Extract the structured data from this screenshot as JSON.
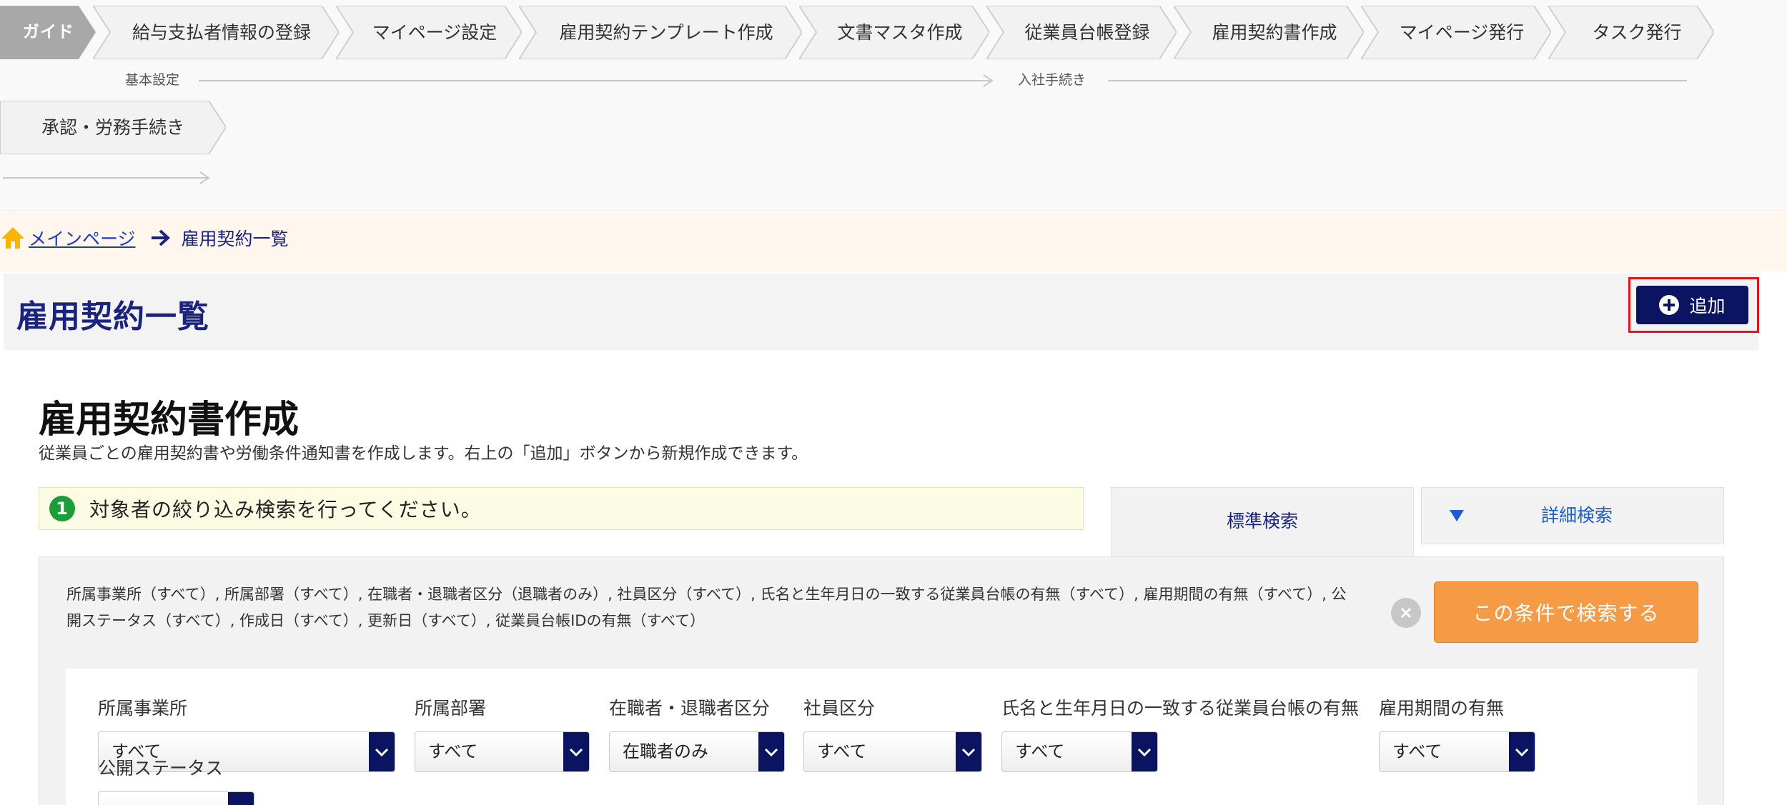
{
  "guide": {
    "badge": "ガイド",
    "steps": [
      "給与支払者情報の登録",
      "マイページ設定",
      "雇用契約テンプレート作成",
      "文書マスタ作成",
      "従業員台帳登録",
      "雇用契約書作成",
      "マイページ発行",
      "タスク発行",
      "承認・労務手続き"
    ],
    "phases": [
      "基本設定",
      "入社手続き"
    ]
  },
  "breadcrumb": {
    "home_icon": "home-icon",
    "home_link": "メインページ",
    "current": "雇用契約一覧"
  },
  "header": {
    "title": "雇用契約一覧",
    "add_label": "追加"
  },
  "content": {
    "title": "雇用契約書作成",
    "description": "従業員ごとの雇用契約書や労働条件通知書を作成します。右上の「追加」ボタンから新規作成できます。",
    "hint_number": "1",
    "hint": "対象者の絞り込み検索を行ってください。"
  },
  "tabs": {
    "standard": "標準検索",
    "detail": "詳細検索"
  },
  "search": {
    "conditions": "所属事業所（すべて）, 所属部署（すべて）, 在職者・退職者区分（退職者のみ）, 社員区分（すべて）, 氏名と生年月日の一致する従業員台帳の有無（すべて）, 雇用期間の有無（すべて）, 公開ステータス（すべて）, 作成日（すべて）, 更新日（すべて）, 従業員台帳IDの有無（すべて）",
    "submit_label": "この条件で検索する",
    "filters": [
      {
        "label": "所属事業所",
        "value": "すべて"
      },
      {
        "label": "所属部署",
        "value": "すべて"
      },
      {
        "label": "在職者・退職者区分",
        "value": "在職者のみ"
      },
      {
        "label": "社員区分",
        "value": "すべて"
      },
      {
        "label": "氏名と生年月日の一致する従業員台帳の有無",
        "value": "すべて"
      },
      {
        "label": "雇用期間の有無",
        "value": "すべて"
      },
      {
        "label": "公開ステータス",
        "value": ""
      }
    ]
  },
  "colors": {
    "navy": "#0b1460",
    "accent_orange": "#f59b45",
    "highlight_red": "#e4141c",
    "guide_badge": "#a8a8a8",
    "hint_green": "#1a9e37"
  }
}
